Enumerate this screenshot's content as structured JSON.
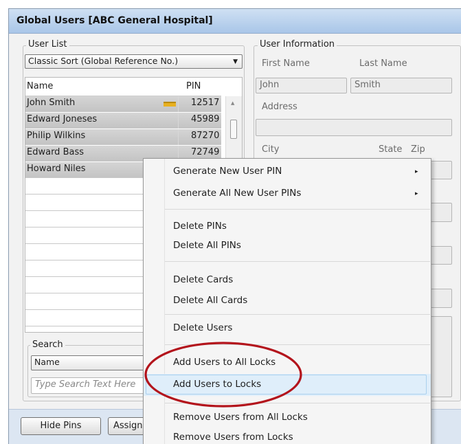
{
  "window": {
    "title": "Global Users [ABC General Hospital]"
  },
  "user_list": {
    "legend": "User List",
    "sort_selected": "Classic Sort (Global Reference No.)",
    "columns": [
      "Name",
      "PIN"
    ],
    "rows": [
      {
        "name": "John Smith",
        "pin": "12517",
        "has_card": true
      },
      {
        "name": "Edward Joneses",
        "pin": "45989"
      },
      {
        "name": "Philip Wilkins",
        "pin": "87270"
      },
      {
        "name": "Edward Bass",
        "pin": "72749"
      },
      {
        "name": "Howard Niles",
        "pin": ""
      }
    ]
  },
  "search": {
    "legend": "Search",
    "field_selected": "Name",
    "placeholder": "Type Search Text Here"
  },
  "user_info": {
    "legend": "User Information",
    "first_name_label": "First Name",
    "last_name_label": "Last Name",
    "first_name": "John",
    "last_name": "Smith",
    "address_label": "Address",
    "address": "",
    "city_label": "City",
    "state_label": "State",
    "zip_label": "Zip"
  },
  "buttons": {
    "hide_pins": "Hide Pins",
    "assign": "Assign"
  },
  "context_menu": {
    "items": [
      {
        "label": "Generate New User PIN",
        "submenu": true
      },
      {
        "label": "Generate All New User PINs",
        "submenu": true
      },
      {
        "label": "Delete PINs"
      },
      {
        "label": "Delete All PINs"
      },
      {
        "label": "Delete Cards"
      },
      {
        "label": "Delete All Cards"
      },
      {
        "label": "Delete Users"
      },
      {
        "label": "Add Users to All Locks"
      },
      {
        "label": "Add Users to Locks",
        "highlighted": true
      },
      {
        "label": "Remove Users from All Locks"
      },
      {
        "label": "Remove Users from Locks"
      }
    ],
    "submenu_arrow": "▸"
  },
  "annotation": {
    "circle_color": "#b3141c"
  },
  "icons": {
    "combo_arrow": "▼",
    "scroll_up": "▲",
    "card": "card-icon"
  }
}
